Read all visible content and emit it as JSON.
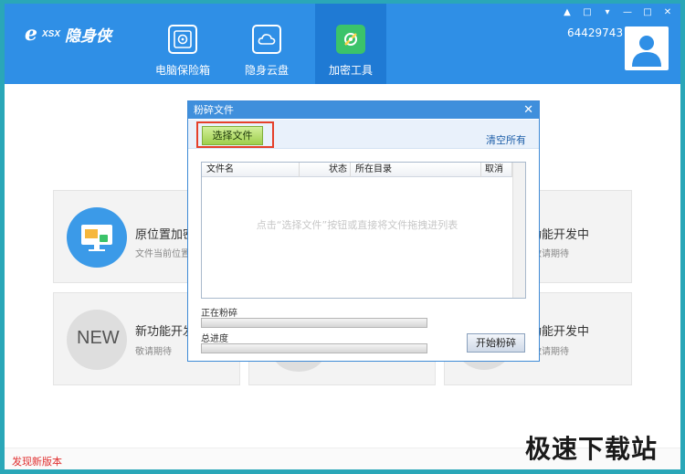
{
  "app": {
    "logo_e": "e",
    "logo_xsx": "XSX",
    "logo_name": "隐身侠",
    "tabs": [
      {
        "label": "电脑保险箱",
        "icon": "safe-icon",
        "active": false
      },
      {
        "label": "隐身云盘",
        "icon": "cloud-icon",
        "active": false
      },
      {
        "label": "加密工具",
        "icon": "tools-icon",
        "active": true
      }
    ],
    "user_id": "64429743",
    "window_controls": [
      "skin-icon",
      "message-icon",
      "dropdown-icon",
      "minimize-icon",
      "maximize-icon",
      "close-icon"
    ],
    "accent_color": "#2f8fe6"
  },
  "cards": [
    {
      "title": "原位置加密",
      "subtitle": "文件当前位置",
      "icon": "folder-monitor-icon"
    },
    {
      "title": "新功能开发中",
      "subtitle": "敬请期待",
      "icon": "new-icon",
      "badge": "NEW"
    },
    {
      "title": "新功能开发中",
      "subtitle": "敬请期待",
      "icon": "placeholder-icon"
    },
    {
      "title": "新功能开发中",
      "subtitle": "敬请期待",
      "icon": "placeholder-icon"
    }
  ],
  "footer": {
    "new_version": "发现新版本",
    "watermark": "极速下载站"
  },
  "dialog": {
    "title": "粉碎文件",
    "select_button": "选择文件",
    "clear_all": "清空所有",
    "columns": [
      "文件名",
      "状态",
      "所在目录",
      "取消"
    ],
    "hint": "点击“选择文件”按钮或直接将文件拖拽进列表",
    "crushing_label": "正在粉碎",
    "total_label": "总进度",
    "crushing_progress": 0,
    "total_progress": 0,
    "start_button": "开始粉碎"
  }
}
